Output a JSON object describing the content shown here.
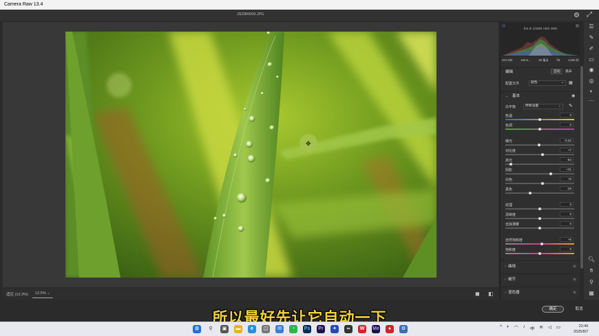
{
  "window": {
    "title": "Camera Raw 13.4"
  },
  "header": {
    "filename": "ZEDB0009.JPG"
  },
  "status": {
    "zoom_fit": "适应 (13.3%)",
    "zoom_value": "12.5%"
  },
  "histogram": {
    "values": "f/4.0   1/200   ISO 200",
    "camera": [
      "ISO 500",
      "150-6...",
      "50 毫米",
      "f/6",
      "1/400 秒"
    ]
  },
  "panel": {
    "edit_label": "编辑",
    "auto_label": "自动",
    "bw_label": "黑白",
    "profile_label": "配置文件",
    "profile_value": "颜色",
    "basic_label": "基本",
    "wb_label": "白平衡",
    "wb_value": "原照设置",
    "sliders": [
      {
        "label": "色温",
        "value": "0",
        "pos": 0.5
      },
      {
        "label": "色调",
        "value": "0",
        "pos": 0.5
      },
      {
        "label": "曝光",
        "value": "-0.02",
        "pos": 0.49
      },
      {
        "label": "对比度",
        "value": "+7",
        "pos": 0.535
      },
      {
        "label": "高光",
        "value": "-84",
        "pos": 0.08
      },
      {
        "label": "阴影",
        "value": "+31",
        "pos": 0.655
      },
      {
        "label": "白色",
        "value": "+8",
        "pos": 0.54
      },
      {
        "label": "黑色",
        "value": "-29",
        "pos": 0.355
      },
      {
        "label": "纹理",
        "value": "0",
        "pos": 0.5
      },
      {
        "label": "清晰度",
        "value": "0",
        "pos": 0.5
      },
      {
        "label": "去除薄雾",
        "value": "0",
        "pos": 0.5
      },
      {
        "label": "自然饱和度",
        "value": "+6",
        "pos": 0.53
      },
      {
        "label": "饱和度",
        "value": "0",
        "pos": 0.5
      }
    ],
    "sections": [
      "曲线",
      "细节",
      "混色器"
    ]
  },
  "actions": {
    "ok": "确定",
    "cancel": "取消"
  },
  "subtitle": "所以最好先让它自动一下",
  "taskbar": {
    "time": "22:46",
    "date": "2025/8/7",
    "ime": "中"
  },
  "colors": {
    "accent": "#f2d23c",
    "panel_bg": "#2f2f2f",
    "canvas_bg": "#383838"
  }
}
